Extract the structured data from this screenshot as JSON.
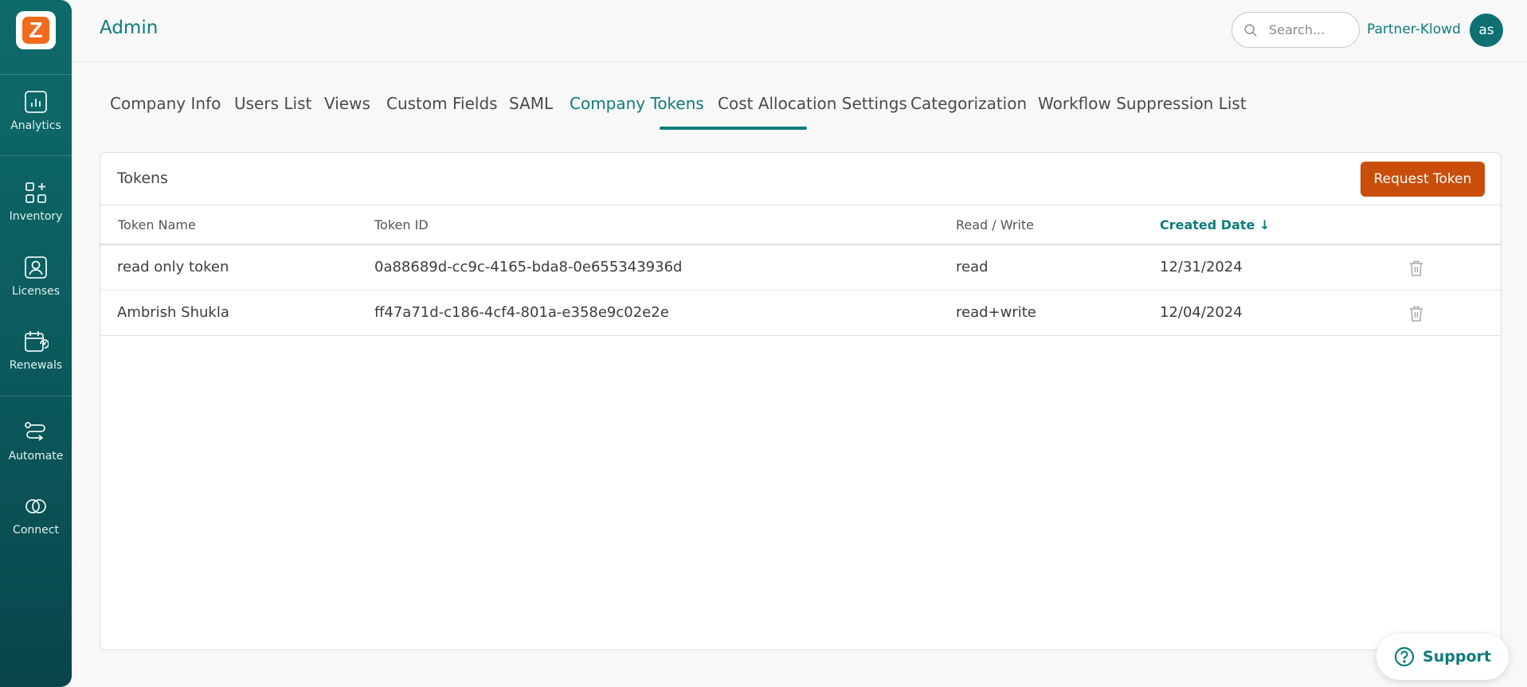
{
  "colors": {
    "primary": "#0e7c7b",
    "sidebar": "#0b5b5d",
    "accent": "#c94e0b",
    "logo": "#f26a1b"
  },
  "logo": {
    "letter": "Z"
  },
  "sidebar": {
    "items": [
      {
        "label": "Analytics",
        "icon": "analytics-icon"
      },
      {
        "label": "Inventory",
        "icon": "inventory-icon"
      },
      {
        "label": "Licenses",
        "icon": "licenses-icon"
      },
      {
        "label": "Renewals",
        "icon": "renewals-icon"
      },
      {
        "label": "Automate",
        "icon": "automate-icon"
      },
      {
        "label": "Connect",
        "icon": "connect-icon"
      }
    ]
  },
  "header": {
    "title": "Admin",
    "search_placeholder": "Search...",
    "partner": "Partner-Klowd",
    "avatar_initials": "as"
  },
  "tabs": [
    {
      "label": "Company Info",
      "active": false
    },
    {
      "label": "Users List",
      "active": false
    },
    {
      "label": "Views",
      "active": false
    },
    {
      "label": "Custom Fields",
      "active": false
    },
    {
      "label": "SAML",
      "active": false
    },
    {
      "label": "Company Tokens",
      "active": true
    },
    {
      "label": "Cost Allocation Settings",
      "active": false
    },
    {
      "label": "Categorization",
      "active": false
    },
    {
      "label": "Workflow Suppression List",
      "active": false
    }
  ],
  "tokens": {
    "title": "Tokens",
    "request_label": "Request Token",
    "columns": {
      "name": "Token Name",
      "id": "Token ID",
      "rw": "Read / Write",
      "created": "Created Date",
      "sort_indicator": "↓"
    },
    "rows": [
      {
        "name": "read only token",
        "id": "0a88689d-cc9c-4165-bda8-0e655343936d",
        "rw": "read",
        "created": "12/31/2024"
      },
      {
        "name": "Ambrish Shukla",
        "id": "ff47a71d-c186-4cf4-801a-e358e9c02e2e",
        "rw": "read+write",
        "created": "12/04/2024"
      }
    ]
  },
  "support": {
    "label": "Support",
    "icon": "help-circle-icon"
  }
}
